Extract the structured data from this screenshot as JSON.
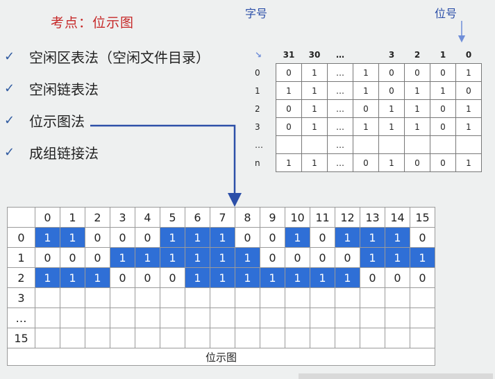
{
  "title": "考点：位示图",
  "bullets": [
    {
      "check": "✓",
      "text": "空闲区表法（空闲文件目录）"
    },
    {
      "check": "✓",
      "text": "空闲链表法"
    },
    {
      "check": "✓",
      "text": "位示图法"
    },
    {
      "check": "✓",
      "text": "成组链接法"
    }
  ],
  "labels": {
    "word_no": "字号",
    "bit_no": "位号"
  },
  "word_table": {
    "corner": "↘",
    "cols": [
      "31",
      "30",
      "…",
      "",
      "3",
      "2",
      "1",
      "0"
    ],
    "rows": [
      {
        "head": "0",
        "cells": [
          "0",
          "1",
          "…",
          "1",
          "0",
          "0",
          "0",
          "1"
        ]
      },
      {
        "head": "1",
        "cells": [
          "1",
          "1",
          "…",
          "1",
          "0",
          "1",
          "1",
          "0"
        ]
      },
      {
        "head": "2",
        "cells": [
          "0",
          "1",
          "…",
          "0",
          "1",
          "1",
          "0",
          "1"
        ]
      },
      {
        "head": "3",
        "cells": [
          "0",
          "1",
          "…",
          "1",
          "1",
          "1",
          "0",
          "1"
        ]
      },
      {
        "head": "…",
        "cells": [
          "",
          "",
          "…",
          "",
          "",
          "",
          "",
          ""
        ]
      },
      {
        "head": "n",
        "cells": [
          "1",
          "1",
          "…",
          "0",
          "1",
          "0",
          "0",
          "1"
        ]
      }
    ]
  },
  "bitmap": {
    "cols": [
      "0",
      "1",
      "2",
      "3",
      "4",
      "5",
      "6",
      "7",
      "8",
      "9",
      "10",
      "11",
      "12",
      "13",
      "14",
      "15"
    ],
    "rows": [
      {
        "head": "0",
        "cells": [
          "1",
          "1",
          "0",
          "0",
          "0",
          "1",
          "1",
          "1",
          "0",
          "0",
          "1",
          "0",
          "1",
          "1",
          "1",
          "0"
        ]
      },
      {
        "head": "1",
        "cells": [
          "0",
          "0",
          "0",
          "1",
          "1",
          "1",
          "1",
          "1",
          "1",
          "0",
          "0",
          "0",
          "0",
          "1",
          "1",
          "1"
        ]
      },
      {
        "head": "2",
        "cells": [
          "1",
          "1",
          "1",
          "0",
          "0",
          "0",
          "1",
          "1",
          "1",
          "1",
          "1",
          "1",
          "1",
          "0",
          "0",
          "0"
        ]
      },
      {
        "head": "3",
        "cells": [
          "",
          "",
          "",
          "",
          "",
          "",
          "",
          "",
          "",
          "",
          "",
          "",
          "",
          "",
          "",
          ""
        ]
      },
      {
        "head": "…",
        "cells": [
          "",
          "",
          "",
          "",
          "",
          "",
          "",
          "",
          "",
          "",
          "",
          "",
          "",
          "",
          "",
          ""
        ]
      },
      {
        "head": "15",
        "cells": [
          "",
          "",
          "",
          "",
          "",
          "",
          "",
          "",
          "",
          "",
          "",
          "",
          "",
          "",
          "",
          ""
        ]
      }
    ],
    "caption": "位示图",
    "fill_color": "#2f6fd6"
  }
}
